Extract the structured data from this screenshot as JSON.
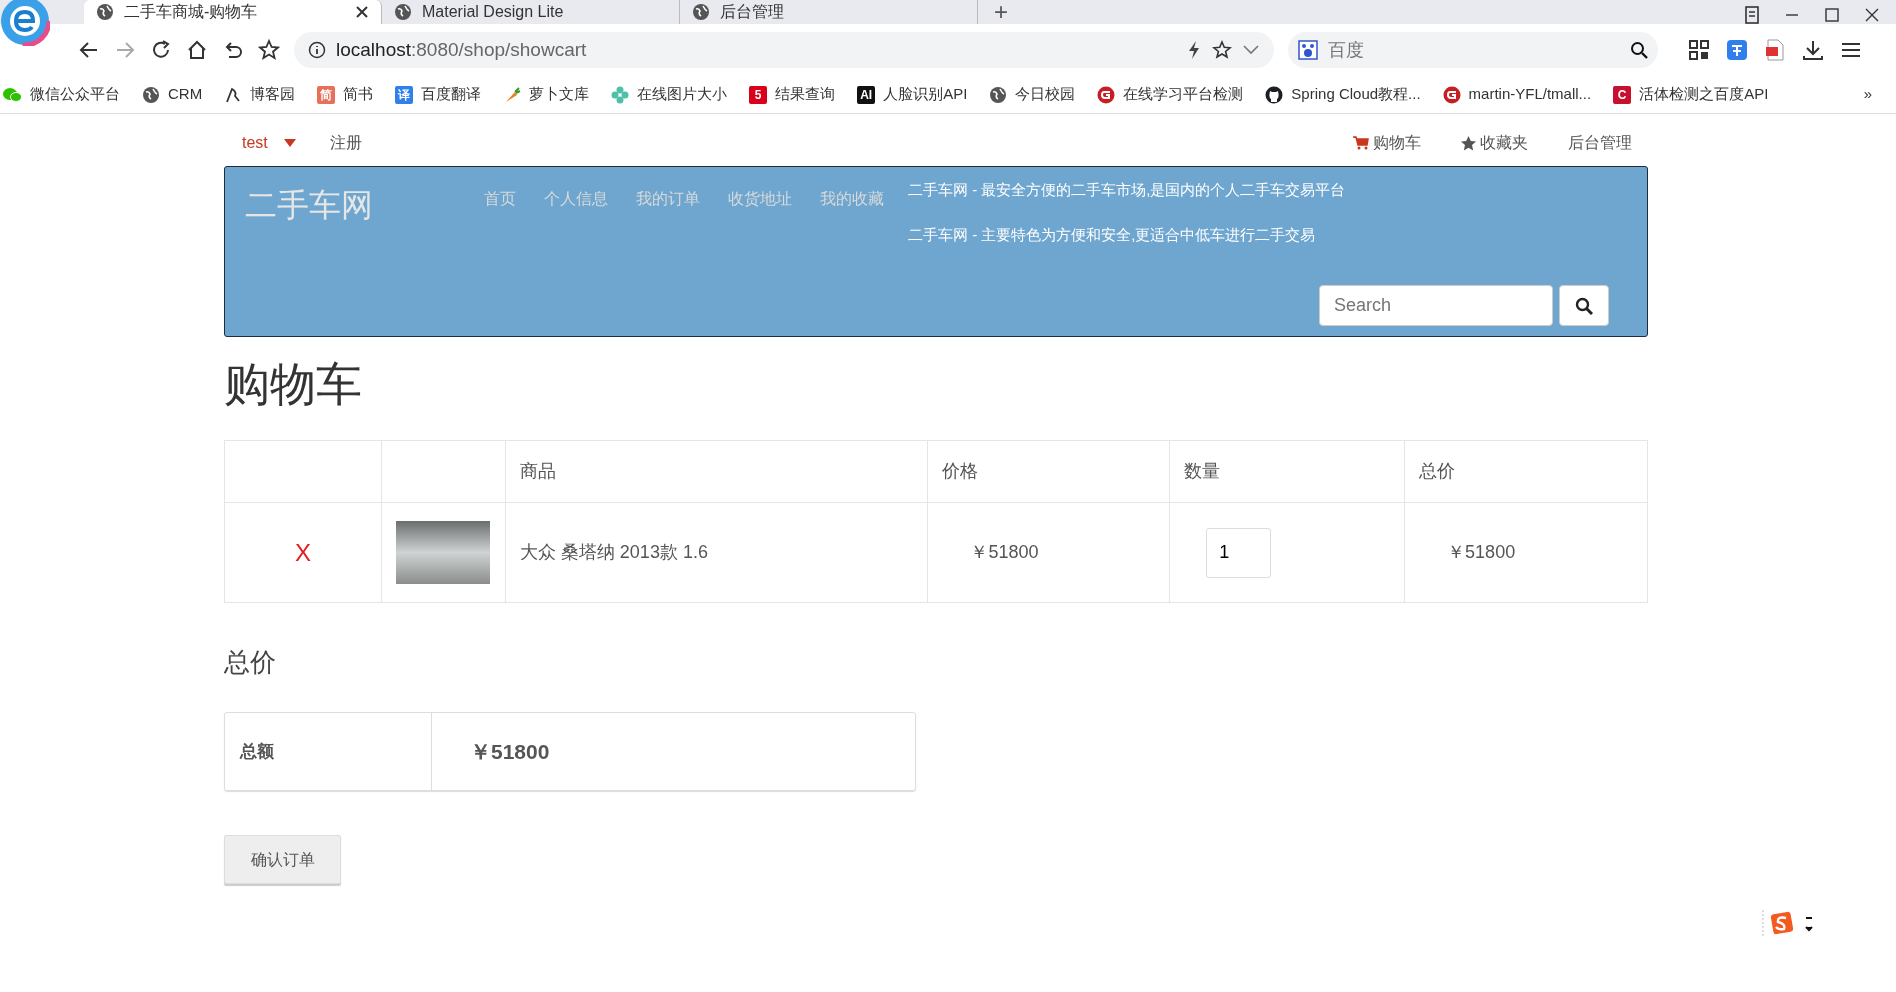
{
  "browser": {
    "tabs": [
      {
        "title": "二手车商城-购物车",
        "selected": true
      },
      {
        "title": "Material Design Lite",
        "selected": false
      },
      {
        "title": "后台管理",
        "selected": false
      }
    ],
    "new_tab": "+",
    "address": {
      "host": "localhost",
      "path": ":8080/shop/showcart"
    },
    "search_placeholder": "百度",
    "bookmarks": [
      {
        "label": "微信公众平台",
        "kind": "wechat"
      },
      {
        "label": "CRM",
        "kind": "globe"
      },
      {
        "label": "博客园",
        "kind": "pen"
      },
      {
        "label": "简书",
        "kind": "badge",
        "glyph": "简",
        "color": "#e8705a"
      },
      {
        "label": "百度翻译",
        "kind": "badge",
        "glyph": "译",
        "color": "#2f80ed"
      },
      {
        "label": "萝卜文库",
        "kind": "carrot"
      },
      {
        "label": "在线图片大小",
        "kind": "flower"
      },
      {
        "label": "结果查询",
        "kind": "badge",
        "glyph": "5",
        "color": "#d9001b"
      },
      {
        "label": "人脸识别API",
        "kind": "badge",
        "glyph": "AI",
        "color": "#111111"
      },
      {
        "label": "今日校园",
        "kind": "globe"
      },
      {
        "label": "在线学习平台检测",
        "kind": "gitee"
      },
      {
        "label": "Spring Cloud教程...",
        "kind": "github"
      },
      {
        "label": "martin-YFL/tmall...",
        "kind": "gitee"
      },
      {
        "label": "活体检测之百度API",
        "kind": "badge",
        "glyph": "C",
        "color": "#c8102e"
      }
    ],
    "overflow": "»"
  },
  "topnav": {
    "user": "test",
    "left_links": [
      "注册"
    ],
    "right_links": [
      {
        "label": "购物车",
        "kind": "cart"
      },
      {
        "label": "收藏夹",
        "kind": "star"
      },
      {
        "label": "后台管理",
        "kind": "plain"
      }
    ]
  },
  "banner": {
    "brand": "二手车网",
    "nav": [
      "首页",
      "个人信息",
      "我的订单",
      "收货地址",
      "我的收藏"
    ],
    "taglines": [
      "二手车网 - 最安全方便的二手车市场,是国内的个人二手车交易平台",
      "二手车网 - 主要特色为方便和安全,更适合中低车进行二手交易"
    ],
    "search_placeholder": "Search"
  },
  "heading": "购物车",
  "table": {
    "columns": [
      "商品",
      "价格",
      "数量",
      "总价"
    ],
    "rows": [
      {
        "remove": "X",
        "product": "大众 桑塔纳 2013款 1.6",
        "price": "￥51800",
        "quantity": "1",
        "total": "￥51800"
      }
    ]
  },
  "summary": {
    "heading": "总价",
    "label": "总额",
    "value": "￥51800"
  },
  "confirm_button": "确认订单"
}
